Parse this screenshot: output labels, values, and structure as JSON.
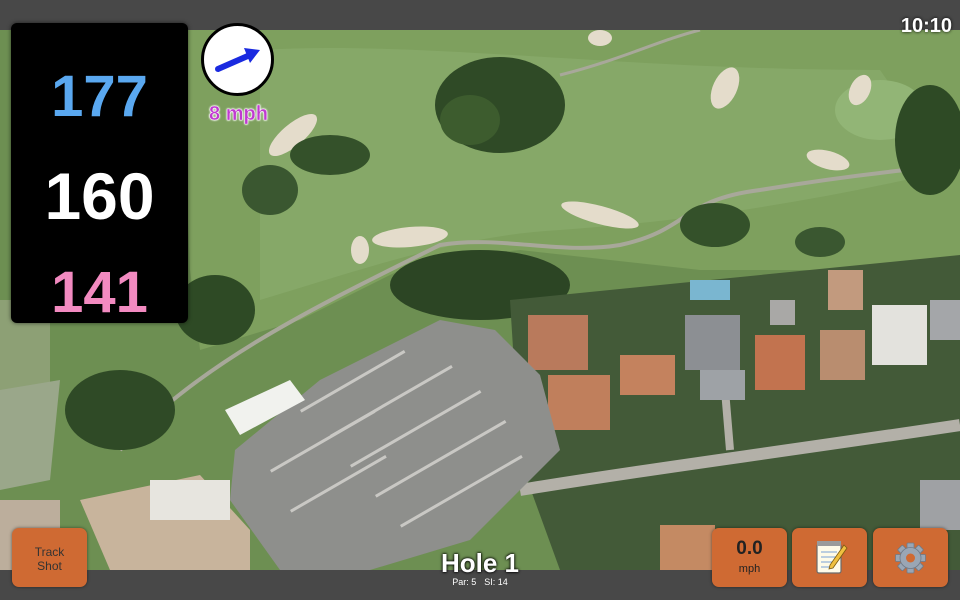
{
  "status": {
    "clock": "10:10"
  },
  "distances": {
    "back": "177",
    "middle": "160",
    "front": "141"
  },
  "wind": {
    "speed_label": "8 mph",
    "icon": "wind-direction-arrow-icon"
  },
  "hole": {
    "title": "Hole 1",
    "par": "Par: 5",
    "si": "SI: 14"
  },
  "buttons": {
    "track_shot": "Track\nShot",
    "speed_value": "0.0",
    "speed_unit": "mph",
    "notes_icon": "notepad-icon",
    "settings_icon": "gear-icon"
  },
  "colors": {
    "back_distance": "#5aa8f0",
    "middle_distance": "#ffffff",
    "front_distance": "#f28ac0",
    "button_bg": "#cf6a33",
    "wind_text": "#c03ad0"
  }
}
